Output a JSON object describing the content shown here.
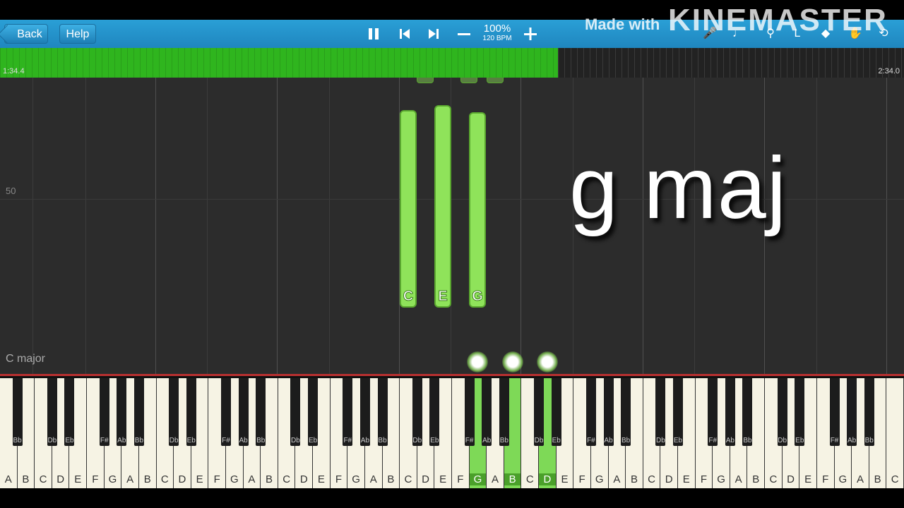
{
  "toolbar": {
    "back_label": "Back",
    "help_label": "Help",
    "zoom_percent": "100%",
    "tempo": "120 BPM",
    "watermark_prefix": "Made with",
    "watermark_brand": "KINEMASTER"
  },
  "timeline": {
    "current_time": "1:34.4",
    "total_time": "2:34.0",
    "progress_fraction": 0.617
  },
  "roll": {
    "measure_number": "50",
    "key_signature": "C major",
    "notes": [
      {
        "pitch": "C",
        "label": "C"
      },
      {
        "pitch": "E",
        "label": "E"
      },
      {
        "pitch": "G",
        "label": "G"
      }
    ]
  },
  "overlay": {
    "chord_text": "g maj"
  },
  "keyboard": {
    "white_keys": [
      "A",
      "B",
      "C",
      "D",
      "E",
      "F",
      "G",
      "A",
      "B",
      "C",
      "D",
      "E",
      "F",
      "G",
      "A",
      "B",
      "C",
      "D",
      "E",
      "F",
      "G",
      "A",
      "B",
      "C",
      "D",
      "E",
      "F",
      "G",
      "A",
      "B",
      "C",
      "D",
      "E",
      "F",
      "G",
      "A",
      "B",
      "C",
      "D",
      "E",
      "F",
      "G",
      "A",
      "B",
      "C",
      "D",
      "E",
      "F",
      "G",
      "A",
      "B",
      "C"
    ],
    "black_keys": [
      "Bb",
      "Db",
      "Eb",
      "F#",
      "Ab",
      "Bb",
      "Db",
      "Eb",
      "F#",
      "Ab",
      "Bb",
      "Db",
      "Eb",
      "F#",
      "Ab",
      "Bb",
      "Db",
      "Eb",
      "F#",
      "Ab",
      "Bb",
      "Db",
      "Eb",
      "F#",
      "Ab",
      "Bb",
      "Db",
      "Eb",
      "F#",
      "Ab",
      "Bb",
      "Db",
      "Eb",
      "F#",
      "Ab",
      "Bb"
    ],
    "lit_white_indexes": [
      27,
      29,
      31
    ]
  },
  "colors": {
    "toolbar": "#1f86bf",
    "progress": "#2fb51e",
    "note": "#8fe35a",
    "lit_key": "#7ed957"
  }
}
